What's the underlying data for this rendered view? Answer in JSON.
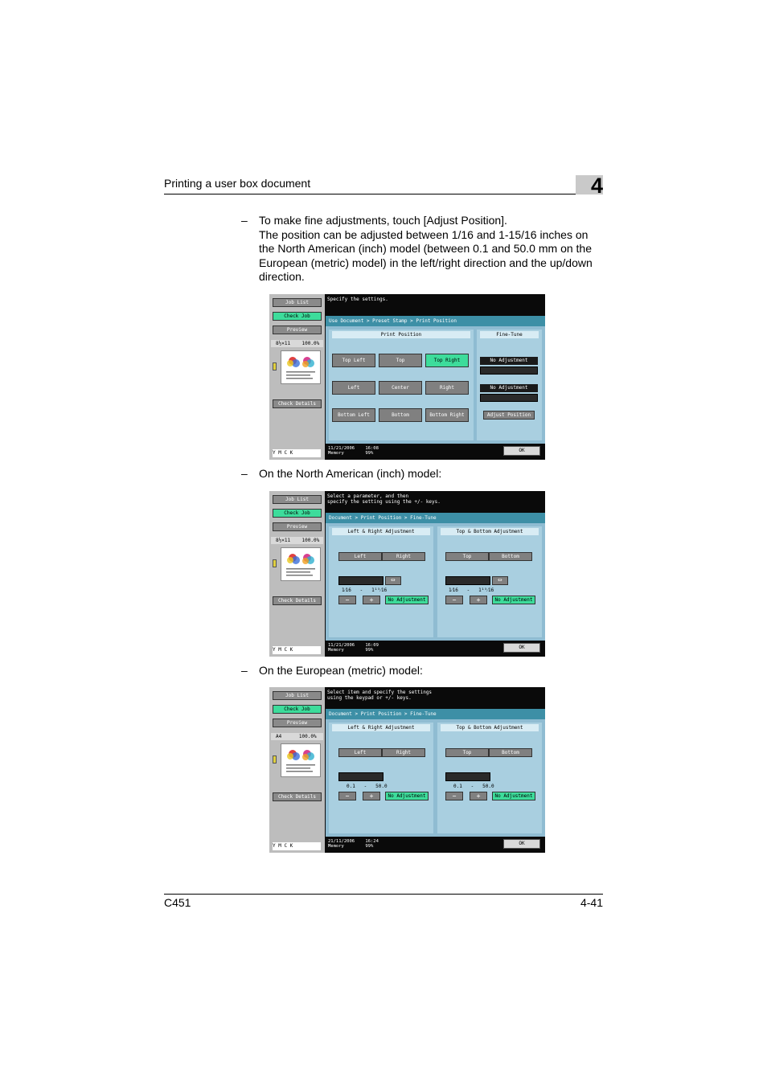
{
  "header": {
    "title": "Printing a user box document",
    "chapter": "4"
  },
  "footer": {
    "model": "C451",
    "page": "4-41"
  },
  "steps": [
    {
      "lines": [
        "To make fine adjustments, touch [Adjust Position].",
        "The position can be adjusted between 1/16 and 1-15/16 inches on",
        "the North American (inch) model (between 0.1 and 50.0 mm on the",
        "European (metric) model) in the left/right direction and the up/down",
        "direction."
      ]
    },
    {
      "lines": [
        "On the North American (inch) model:"
      ]
    },
    {
      "lines": [
        "On the European (metric) model:"
      ]
    }
  ],
  "dash": "–",
  "left_panel": {
    "job_list": "Job List",
    "check_job": "Check Job",
    "preview": "Preview",
    "check_details": "Check Details",
    "zoom": "100.0%",
    "paper_a": "8½×11",
    "paper_b": "A4",
    "toner": "Y  M  C  K"
  },
  "screen1": {
    "message": "Specify the settings.",
    "breadcrumb": "Use Document > Preset Stamp > Print Position",
    "panel_title": "Print Position",
    "fine_title": "Fine-Tune",
    "buttons": [
      "Top Left",
      "Top",
      "Top Right",
      "Left",
      "Center",
      "Right",
      "Bottom Left",
      "Bottom",
      "Bottom Right"
    ],
    "selected": "Top Right",
    "no_adjust_1": "No Adjustment",
    "no_adjust_2": "No Adjustment",
    "adjust_position": "Adjust Position",
    "date": "11/21/2006    16:08",
    "memory": "Memory        99%",
    "ok": "OK"
  },
  "screen2": {
    "message": "Select a parameter, and then\nspecify the setting using the +/- keys.",
    "breadcrumb": "Document > Print Position > Fine-Tune",
    "lr_title": "Left & Right Adjustment",
    "tb_title": "Top & Bottom Adjustment",
    "left": "Left",
    "right": "Right",
    "top": "Top",
    "bottom": "Bottom",
    "swap": "⇔",
    "range": "1⁄16   -   1¹⁵⁄16",
    "minus": "−",
    "plus": "+",
    "no_adjust": "No Adjustment",
    "date": "11/21/2006    16:09",
    "memory": "Memory        99%",
    "ok": "OK"
  },
  "screen3": {
    "message": "Select item and specify the settings\nusing the keypad or +/- keys.",
    "breadcrumb": "Document > Print Position > Fine-Tune",
    "lr_title": "Left & Right Adjustment",
    "tb_title": "Top & Bottom Adjustment",
    "left": "Left",
    "right": "Right",
    "top": "Top",
    "bottom": "Bottom",
    "range": "0.1   -   50.0",
    "minus": "−",
    "plus": "+",
    "no_adjust": "No Adjustment",
    "date": "21/11/2006    16:24",
    "memory": "Memory        99%",
    "ok": "OK"
  }
}
